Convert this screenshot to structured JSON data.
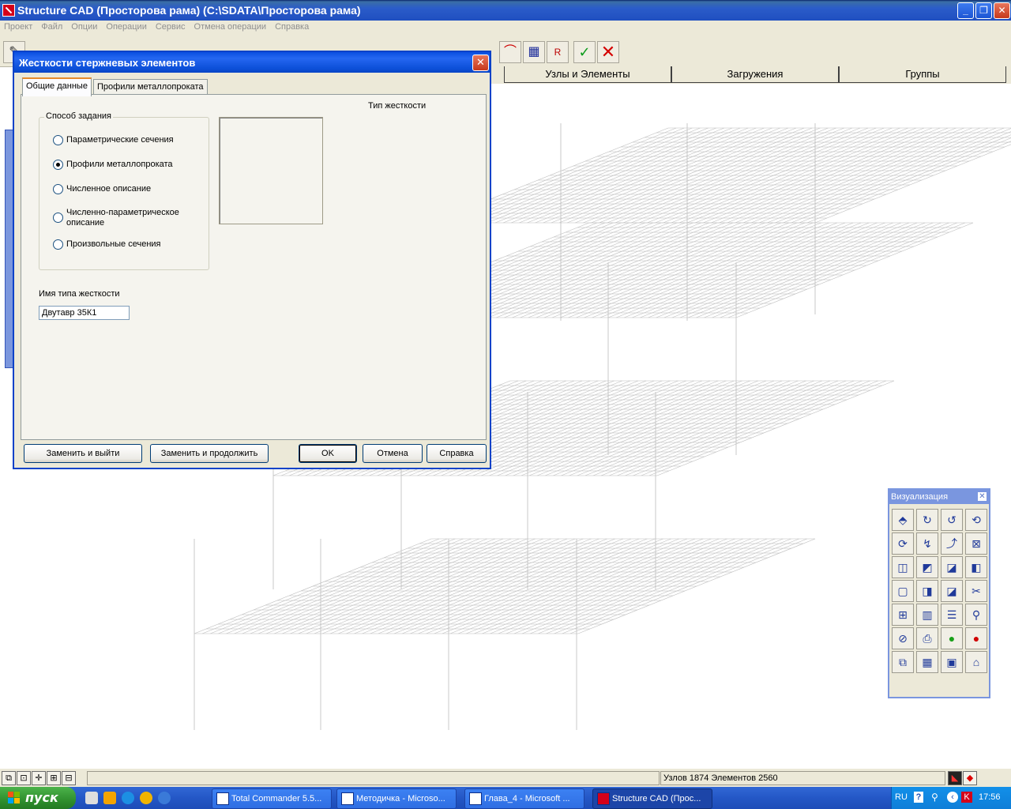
{
  "window": {
    "title": "Structure CAD (Просторова рама) (C:\\SDATA\\Просторова рама)",
    "min_label": "_",
    "max_label": "❐",
    "close_label": "✕"
  },
  "menu": {
    "items": [
      "Проект",
      "Файл",
      "Опции",
      "Операции",
      "Сервис",
      "Отмена операции",
      "Справка"
    ]
  },
  "main_tabs": [
    {
      "label": "Узлы и Элементы"
    },
    {
      "label": "Загружения"
    },
    {
      "label": "Группы"
    }
  ],
  "dialog": {
    "title": "Жесткости стержневых элементов",
    "close_label": "✕",
    "tabs": [
      "Общие данные",
      "Профили металлопроката"
    ],
    "method_group_label": "Способ задания",
    "methods": [
      {
        "label": "Параметрические сечения",
        "selected": false
      },
      {
        "label": "Профили металлопроката",
        "selected": true
      },
      {
        "label": "Численное описание",
        "selected": false
      },
      {
        "label": "Численно-параметрическое",
        "label2": "описание",
        "selected": false
      },
      {
        "label": "Произвольные сечения",
        "selected": false
      }
    ],
    "stiffness_type_label": "Тип жесткости",
    "name_label": "Имя типа жесткости",
    "name_value": "Двутавр 35К1",
    "buttons": {
      "replace_exit": "Заменить и выйти",
      "replace_continue": "Заменить и продолжить",
      "ok": "OK",
      "cancel": "Отмена",
      "help": "Справка"
    }
  },
  "visualization": {
    "title": "Визуализация",
    "close_label": "✕"
  },
  "status": {
    "info": "Узлов 1874 Элементов 2560"
  },
  "taskbar": {
    "start_label": "пуск",
    "tasks": [
      {
        "label": "Total Commander 5.5..."
      },
      {
        "label": "Методичка - Microso..."
      },
      {
        "label": "Глава_4 - Microsoft ..."
      },
      {
        "label": "Structure CAD (Прос..."
      }
    ],
    "lang": "RU",
    "clock": "17:56"
  },
  "colors": {
    "title_blue": "#0a4fe0",
    "face": "#ece9d8",
    "mesh": "#bdbdbd",
    "taskbar": "#2457c6"
  }
}
